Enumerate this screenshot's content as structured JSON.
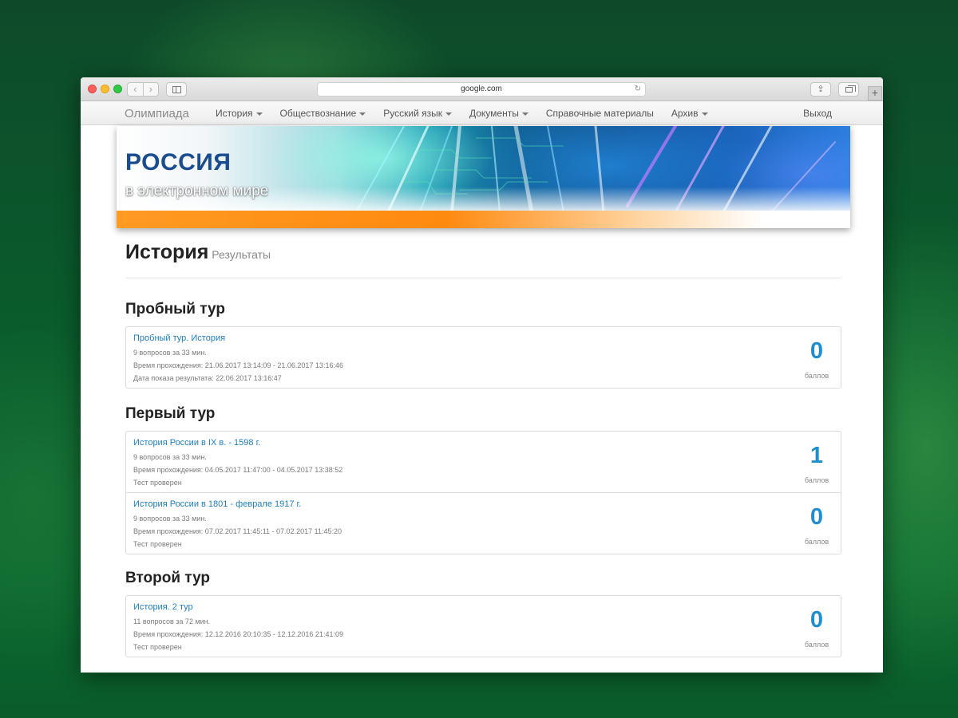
{
  "browser": {
    "url": "google.com"
  },
  "navbar": {
    "brand": "Олимпиада",
    "items": [
      {
        "label": "История",
        "dropdown": true
      },
      {
        "label": "Обществознание",
        "dropdown": true
      },
      {
        "label": "Русский язык",
        "dropdown": true
      },
      {
        "label": "Документы",
        "dropdown": true
      },
      {
        "label": "Справочные материалы",
        "dropdown": false
      },
      {
        "label": "Архив",
        "dropdown": true
      }
    ],
    "logout": "Выход"
  },
  "banner": {
    "title": "РОССИЯ",
    "subtitle": "в электронном мире"
  },
  "page": {
    "title": "История",
    "subtitle": "Результаты"
  },
  "sections": [
    {
      "title": "Пробный тур",
      "items": [
        {
          "title": "Пробный тур. История",
          "lines": [
            "9 вопросов за 33 мин.",
            "Время прохождения: 21.06.2017 13:14:09 - 21.06.2017 13:16:46",
            "Дата показа результата: 22.06.2017 13:16:47"
          ],
          "score": "0",
          "score_label": "баллов"
        }
      ]
    },
    {
      "title": "Первый тур",
      "items": [
        {
          "title": "История России в IX в. - 1598 г.",
          "lines": [
            "9 вопросов за 33 мин.",
            "Время прохождения: 04.05.2017 11:47:00 - 04.05.2017 13:38:52",
            "Тест проверен"
          ],
          "score": "1",
          "score_label": "баллов"
        },
        {
          "title": "История России в 1801 - феврале 1917 г.",
          "lines": [
            "9 вопросов за 33 мин.",
            "Время прохождения: 07.02.2017 11:45:11 - 07.02.2017 11:45:20",
            "Тест проверен"
          ],
          "score": "0",
          "score_label": "баллов"
        }
      ]
    },
    {
      "title": "Второй тур",
      "items": [
        {
          "title": "История. 2 тур",
          "lines": [
            "11 вопросов за 72 мин.",
            "Время прохождения: 12.12.2016 20:10:35 - 12.12.2016 21:41:09",
            "Тест проверен"
          ],
          "score": "0",
          "score_label": "баллов"
        }
      ]
    }
  ],
  "colors": {
    "link": "#1d7fc0",
    "score": "#1d8fd1",
    "banner_title": "#1a4d8f",
    "banner_accent": "#ff8a10",
    "background": "#0a5a2c"
  }
}
